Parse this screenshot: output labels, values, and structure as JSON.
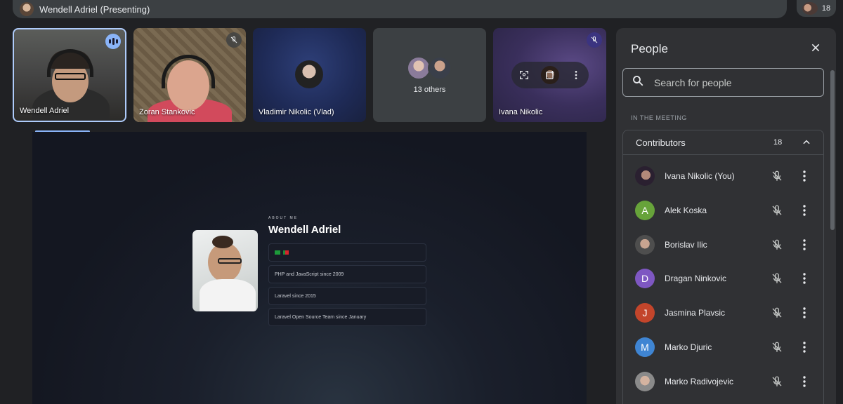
{
  "topbar": {
    "presenter_title": "Wendell Adriel (Presenting)",
    "participant_count": "18"
  },
  "tiles": [
    {
      "name": "Wendell Adriel",
      "status": "speaking"
    },
    {
      "name": "Zoran Stankovic",
      "status": "muted"
    },
    {
      "name": "Vladimir Nikolic (Vlad)",
      "status": ""
    },
    {
      "name": "13 others",
      "status": ""
    },
    {
      "name": "Ivana Nikolic",
      "status": "muted"
    }
  ],
  "presentation": {
    "about_label": "ABOUT ME",
    "name": "Wendell Adriel",
    "facts": [
      "PHP and JavaScript since 2009",
      "Laravel since 2015",
      "Laravel Open Source Team since January"
    ]
  },
  "people_panel": {
    "title": "People",
    "search_placeholder": "Search for people",
    "section_label": "IN THE MEETING",
    "group_label": "Contributors",
    "group_count": "18",
    "people": [
      {
        "name": "Ivana Nikolic (You)",
        "initial": "",
        "avatar_color": "#2a2030"
      },
      {
        "name": "Alek Koska",
        "initial": "A",
        "avatar_color": "#67a33a"
      },
      {
        "name": "Borislav Ilic",
        "initial": "",
        "avatar_color": "#555555"
      },
      {
        "name": "Dragan Ninkovic",
        "initial": "D",
        "avatar_color": "#7e57c2"
      },
      {
        "name": "Jasmina Plavsic",
        "initial": "J",
        "avatar_color": "#c3452b"
      },
      {
        "name": "Marko Djuric",
        "initial": "M",
        "avatar_color": "#3f85d3"
      },
      {
        "name": "Marko Radivojevic",
        "initial": "",
        "avatar_color": "#8a8a8a"
      }
    ]
  },
  "colors": {
    "accent_blue": "#8ab4f8",
    "panel_bg": "#303134",
    "page_bg": "#202124"
  }
}
